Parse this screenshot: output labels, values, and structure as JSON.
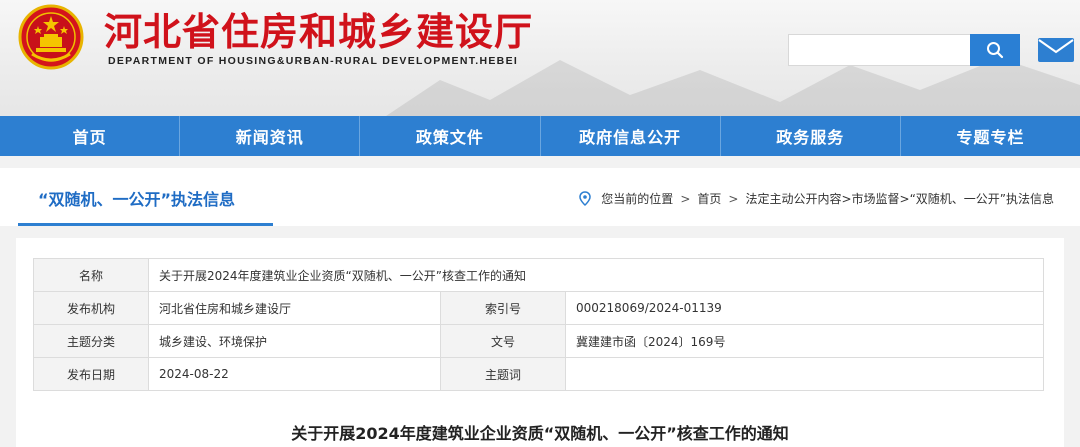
{
  "header": {
    "title": "河北省住房和城乡建设厅",
    "subtitle": "DEPARTMENT OF HOUSING&URBAN-RURAL DEVELOPMENT.HEBEI",
    "search": {
      "value": "",
      "placeholder": ""
    },
    "icons": {
      "emblem": "national-emblem",
      "search": "search-icon",
      "mail": "mail-icon"
    },
    "brand_color": "#d0121b"
  },
  "nav": {
    "items": [
      {
        "label": "首页"
      },
      {
        "label": "新闻资讯"
      },
      {
        "label": "政策文件"
      },
      {
        "label": "政府信息公开"
      },
      {
        "label": "政务服务"
      },
      {
        "label": "专题专栏"
      }
    ],
    "color": "#2d7fd1"
  },
  "section": {
    "title": "“双随机、一公开”执法信息",
    "breadcrumb": {
      "prefix": "您当前的位置",
      "items": [
        "首页",
        "法定主动公开内容>市场监督>“双随机、一公开”执法信息"
      ]
    }
  },
  "meta_table": {
    "rows": [
      {
        "label1": "名称",
        "value1": "关于开展2024年度建筑业企业资质“双随机、一公开”核查工作的通知"
      },
      {
        "label1": "发布机构",
        "value1": "河北省住房和城乡建设厅",
        "label2": "索引号",
        "value2": "000218069/2024-01139"
      },
      {
        "label1": "主题分类",
        "value1": "城乡建设、环境保护",
        "label2": "文号",
        "value2": "冀建建市函〔2024〕169号"
      },
      {
        "label1": "发布日期",
        "value1": "2024-08-22",
        "label2": "主题词",
        "value2": ""
      }
    ]
  },
  "document": {
    "title": "关于开展2024年度建筑业企业资质“双随机、一公开”核查工作的通知"
  }
}
